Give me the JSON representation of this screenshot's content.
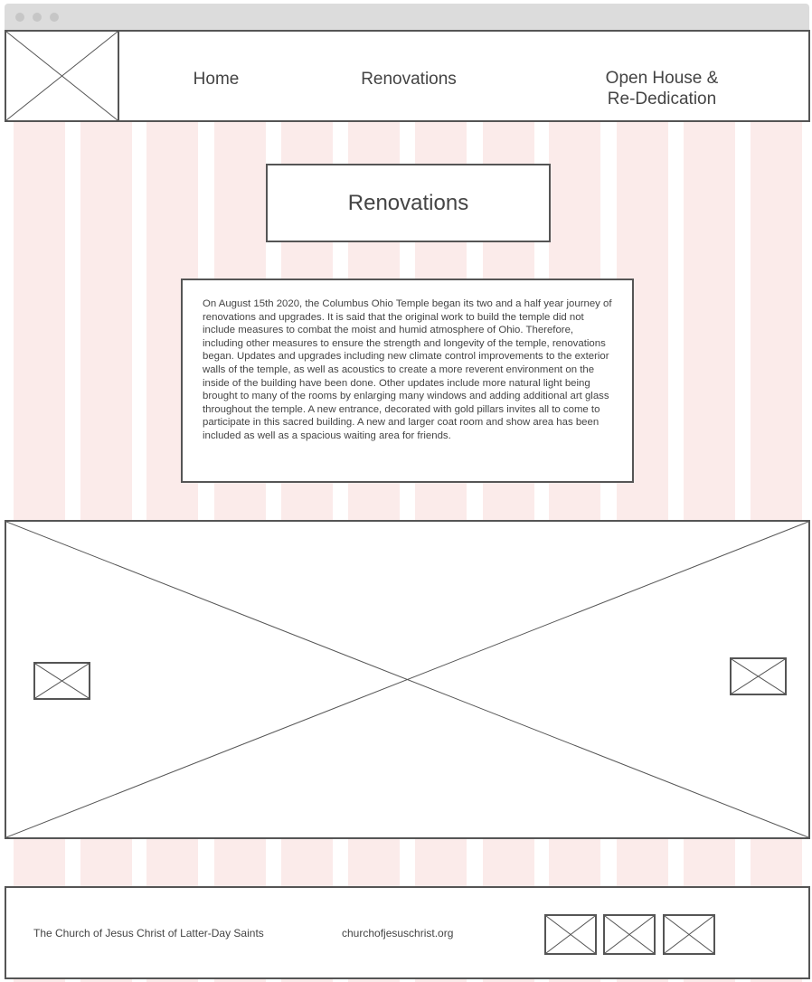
{
  "window": {
    "controls": [
      "close",
      "minimize",
      "maximize"
    ]
  },
  "header": {
    "logo": "image-placeholder-icon",
    "nav": [
      {
        "label": "Home"
      },
      {
        "label": "Renovations"
      },
      {
        "label": "Open House &\nRe-Dedication"
      }
    ]
  },
  "main": {
    "title": "Renovations",
    "body": "On August 15th 2020, the Columbus Ohio Temple began its two and a half year journey of renovations and upgrades. It is said that the original work to build the temple did not include measures to combat the moist and humid atmosphere of Ohio. Therefore, including other measures to ensure the strength and longevity of the temple, renovations began. Updates and upgrades including new climate control improvements to the exterior walls of the temple, as well as acoustics to create a more reverent environment on the inside of the building have been done. Other updates include more natural light being brought to many of the rooms by enlarging many windows and adding additional art glass throughout the temple. A new entrance, decorated with gold pillars invites all to come to participate in this sacred building. A new and larger coat room and show area has been included as well as a spacious waiting area for friends."
  },
  "carousel": {
    "image": "image-placeholder-icon",
    "prev": "image-placeholder-icon",
    "next": "image-placeholder-icon"
  },
  "footer": {
    "organization": "The Church of Jesus Christ of Latter-Day Saints",
    "website": "churchofjesuschrist.org",
    "social_icons": [
      "image-placeholder-icon",
      "image-placeholder-icon",
      "image-placeholder-icon"
    ]
  },
  "colors": {
    "grid_column": "#fbebea",
    "border": "#555555",
    "titlebar": "#dcdcdc",
    "text": "#444444"
  }
}
